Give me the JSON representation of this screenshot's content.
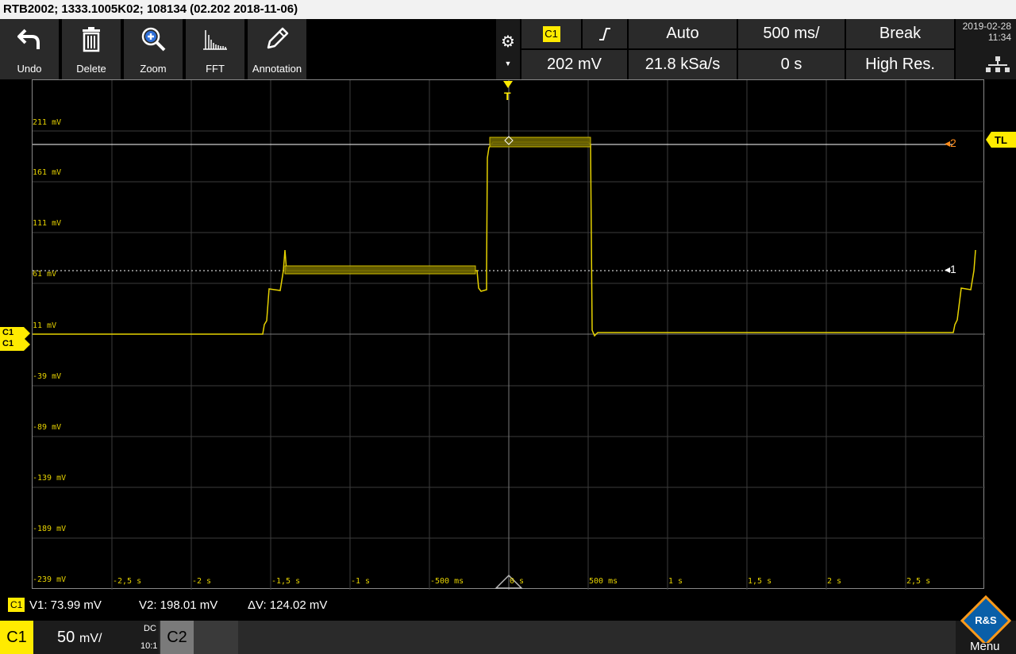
{
  "title": "RTB2002; 1333.1005K02; 108134 (02.202 2018-11-06)",
  "toolbar": {
    "undo": "Undo",
    "delete": "Delete",
    "zoom": "Zoom",
    "fft": "FFT",
    "annotation": "Annotation"
  },
  "trigger": {
    "source": "C1",
    "mode": "Auto",
    "timebase": "500 ms/",
    "stop_mode": "Break",
    "level": "202 mV",
    "sample_rate": "21.8 kSa/s",
    "position": "0 s",
    "acq_mode": "High Res."
  },
  "datetime": {
    "date": "2019-02-28",
    "time": "11:34"
  },
  "axis": {
    "y_labels": [
      "211 mV",
      "161 mV",
      "111 mV",
      "61 mV",
      "11 mV",
      "-39 mV",
      "-89 mV",
      "-139 mV",
      "-189 mV",
      "-239 mV"
    ],
    "x_labels": [
      "-2,5 s",
      "-2 s",
      "-1,5 s",
      "-1 s",
      "-500 ms",
      "0 s",
      "500 ms",
      "1 s",
      "1,5 s",
      "2 s",
      "2,5 s"
    ]
  },
  "markers": {
    "c1_top": "C1",
    "c1_bottom": "C1",
    "tl": "TL",
    "cursor2": "2",
    "cursor1": "1",
    "trigger_t": "T"
  },
  "measure": {
    "badge": "C1",
    "v1": "V1: 73.99 mV",
    "v2": "V2: 198.01 mV",
    "dv": "ΔV: 124.02 mV"
  },
  "channel": {
    "c1": "C1",
    "scale": "50",
    "unit": "mV/",
    "coupling": "DC",
    "probe": "10:1",
    "c2": "C2"
  },
  "menu": {
    "label": "Menu",
    "logo": "R&S"
  },
  "colors": {
    "accent": "#ffeb00",
    "cursor2": "#ff8c1a",
    "grid": "#444444"
  }
}
